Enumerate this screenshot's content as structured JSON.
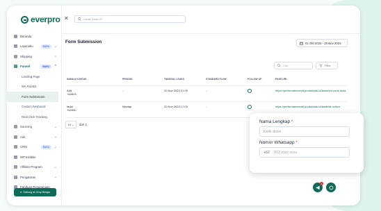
{
  "brand": {
    "name": "everpro"
  },
  "sidebar": {
    "items": [
      {
        "label": "Beranda"
      },
      {
        "label": "Layanaku",
        "badge": "BARU"
      },
      {
        "label": "Shipping"
      },
      {
        "label": "Funnel",
        "badge": "BARU"
      },
      {
        "label": "Sourcing"
      },
      {
        "label": "Ads"
      },
      {
        "label": "CRM",
        "badge": "BARU"
      },
      {
        "label": "WP Enabler"
      },
      {
        "label": "Affiliate Program"
      },
      {
        "label": "Pengaturan"
      },
      {
        "label": "Panduan Penggunaan"
      }
    ],
    "subitems": [
      "Landing Page",
      "WA Rotator",
      "Form Submission",
      "Custom Keyboard",
      "Real Click Tracking"
    ],
    "cta": "Gabung ke Grup Belajar"
  },
  "topbar": {
    "search_placeholder": "Lacak Order ID"
  },
  "page": {
    "title": "Form Submission",
    "date_range": "01 Okt 2023 - 20 Nov 2023"
  },
  "toolbar": {
    "find_placeholder": "Cari",
    "filter_label": "Filter"
  },
  "table": {
    "headers": [
      "NAMA & KONTAK",
      "PRODUK",
      "TANGGAL LEADS",
      "STANDARD FLOW",
      "FOLLOW UP",
      "PAGE URL"
    ],
    "rows": [
      {
        "name": "Adit",
        "phone": "+62823",
        "product": "-",
        "date": "20 Nov 2023 21:09",
        "flow": "-",
        "url": "https://performanceedit.produkbisk.id/landetim-coulr.duka"
      },
      {
        "name": "Iadal",
        "phone": "+62830",
        "product": "Mantap",
        "date": "20 Nov 2023 17:03",
        "flow": "-",
        "url": "https://performanceedit.produkbisk.id/landetik.co/bpz"
      }
    ]
  },
  "pager": {
    "per_page": "10",
    "label": "dari 2"
  },
  "popup": {
    "name_label": "Nama Lengkap",
    "name_placeholder": "Ketik disini",
    "wa_label": "Nomor Whatsapp",
    "wa_prefix": "+62",
    "wa_placeholder": "812 xxxx xxxx",
    "required_mark": "*"
  },
  "fab": {
    "notif_count": "2"
  }
}
